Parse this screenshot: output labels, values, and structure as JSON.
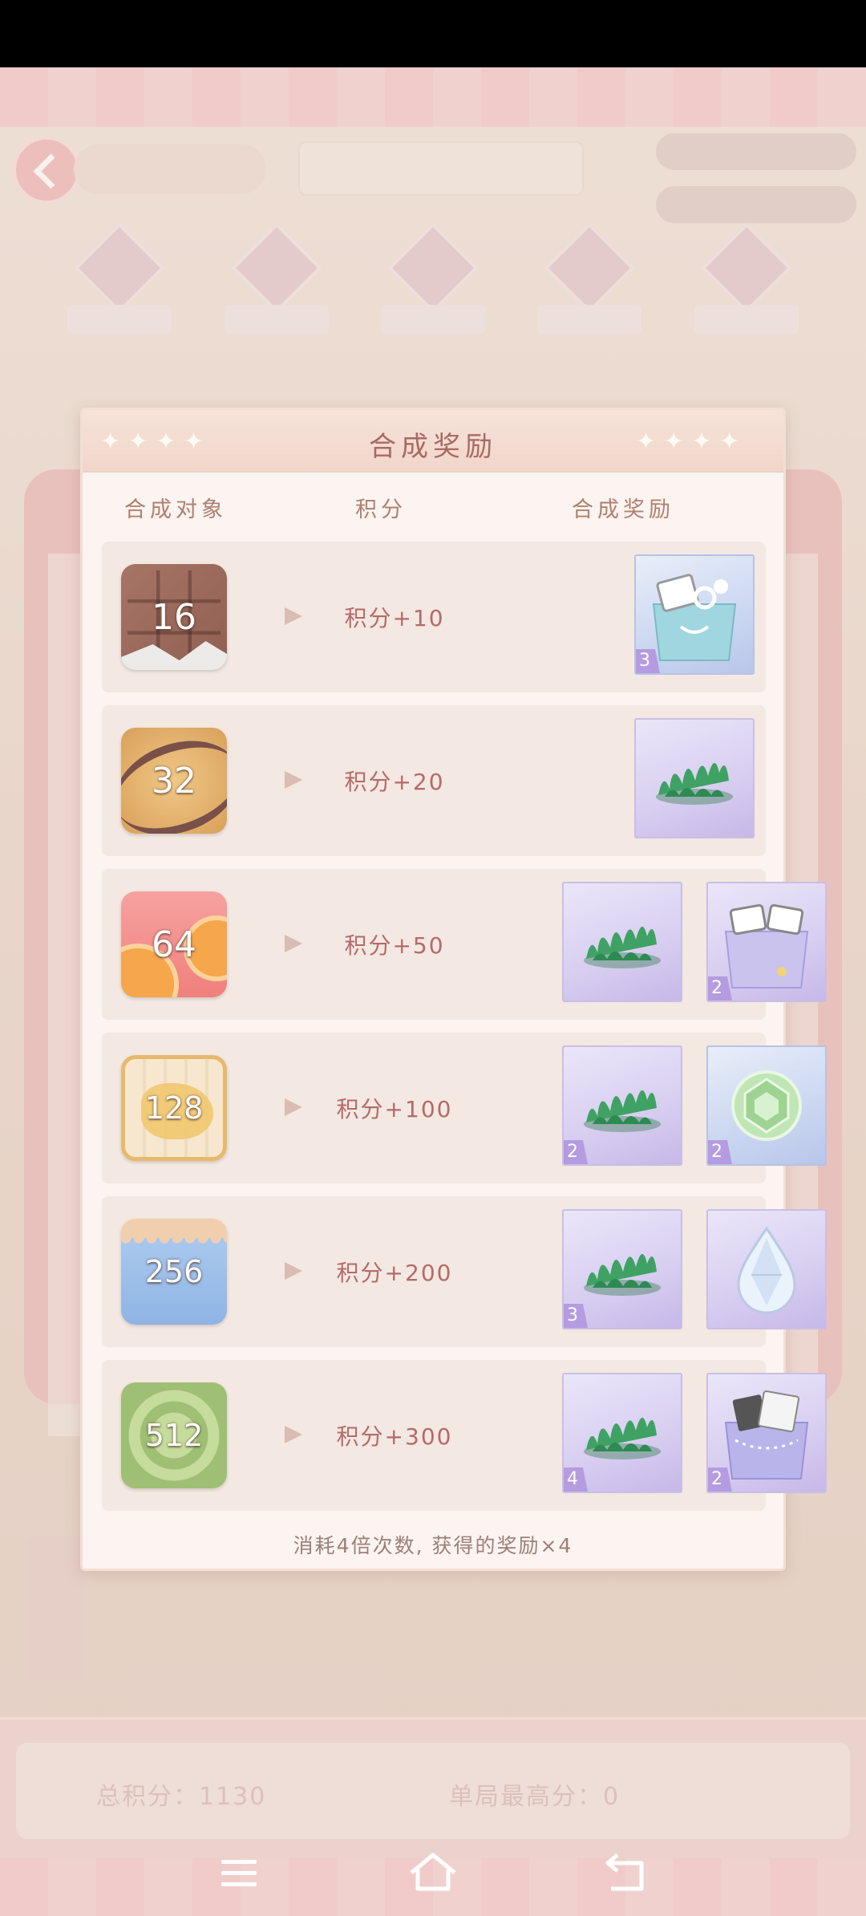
{
  "background": {
    "total_score_label": "总积分：1130",
    "best_score_label": "单局最高分：0"
  },
  "dialog": {
    "title": "合成奖励",
    "columns": {
      "target": "合成对象",
      "points": "积分",
      "reward": "合成奖励"
    },
    "rows": [
      {
        "tile": "16",
        "points": "积分+10",
        "rewards": [
          {
            "icon": "gift-bag-icon",
            "count": "3"
          }
        ]
      },
      {
        "tile": "32",
        "points": "积分+20",
        "rewards": [
          {
            "icon": "green-plant-icon",
            "count": ""
          }
        ]
      },
      {
        "tile": "64",
        "points": "积分+50",
        "rewards": [
          {
            "icon": "green-plant-icon",
            "count": ""
          },
          {
            "icon": "gift-bag-icon",
            "count": "2"
          }
        ]
      },
      {
        "tile": "128",
        "points": "积分+100",
        "rewards": [
          {
            "icon": "green-plant-icon",
            "count": "2"
          },
          {
            "icon": "green-gem-icon",
            "count": "2"
          }
        ]
      },
      {
        "tile": "256",
        "points": "积分+200",
        "rewards": [
          {
            "icon": "green-plant-icon",
            "count": "3"
          },
          {
            "icon": "diamond-drop-icon",
            "count": ""
          }
        ]
      },
      {
        "tile": "512",
        "points": "积分+300",
        "rewards": [
          {
            "icon": "green-plant-icon",
            "count": "4"
          },
          {
            "icon": "gift-bag-icon",
            "count": "2"
          }
        ]
      }
    ],
    "footer_note": "消耗4倍次数, 获得的奖励×4"
  },
  "colors": {
    "accent": "#b56a6a",
    "title": "#a86a64",
    "reward_badge": "#b59be0"
  }
}
